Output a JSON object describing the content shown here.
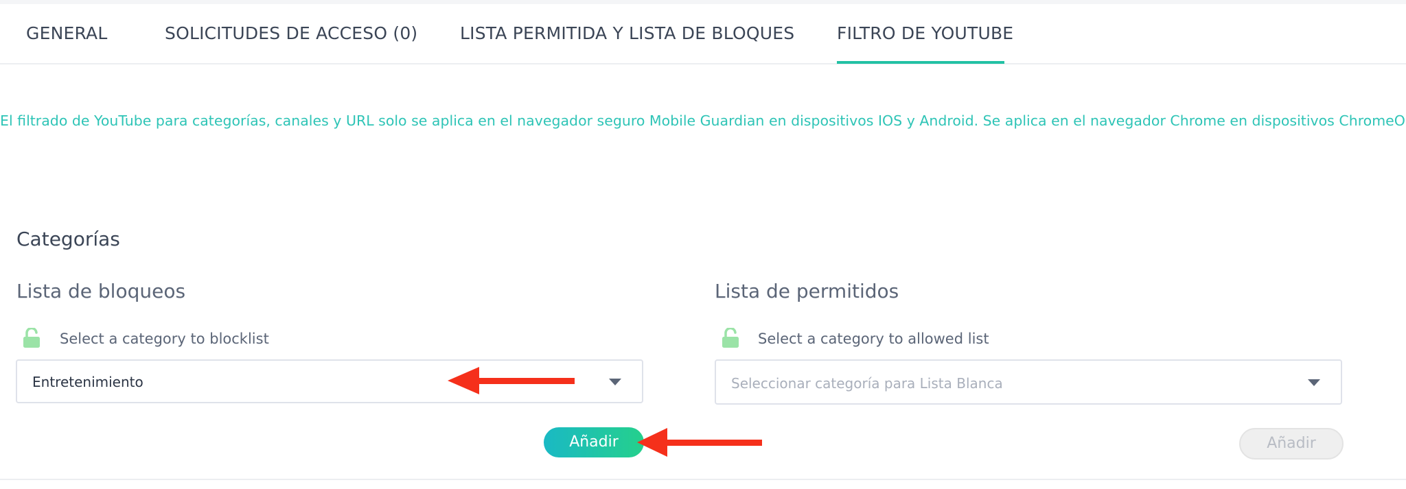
{
  "tabs": [
    {
      "label": "GENERAL"
    },
    {
      "label": "SOLICITUDES DE ACCESO (0)"
    },
    {
      "label": "LISTA PERMITIDA Y LISTA DE BLOQUES"
    },
    {
      "label": "FILTRO DE YOUTUBE",
      "active": true
    }
  ],
  "info_text": "El filtrado de YouTube para categorías, canales y URL solo se aplica en el navegador seguro Mobile Guardian en dispositivos IOS y Android. Se aplica en el navegador Chrome en dispositivos ChromeOS.",
  "section_title": "Categorías",
  "blocklist": {
    "title": "Lista de bloqueos",
    "hint": "Select a category to blocklist",
    "selected_value": "Entretenimiento",
    "add_button": "Añadir"
  },
  "allowlist": {
    "title": "Lista de permitidos",
    "hint": "Select a category to allowed list",
    "placeholder": "Seleccionar categoría para Lista Blanca",
    "add_button": "Añadir"
  },
  "colors": {
    "accent": "#22c1a4",
    "info_text": "#2ec4b6",
    "lock_icon": "#9be3a7",
    "annotation_arrow": "#f5301b"
  },
  "icons": {
    "lock": "unlocked-padlock-icon",
    "dropdown": "caret-down-icon",
    "annotation": "red-arrow-icon"
  }
}
